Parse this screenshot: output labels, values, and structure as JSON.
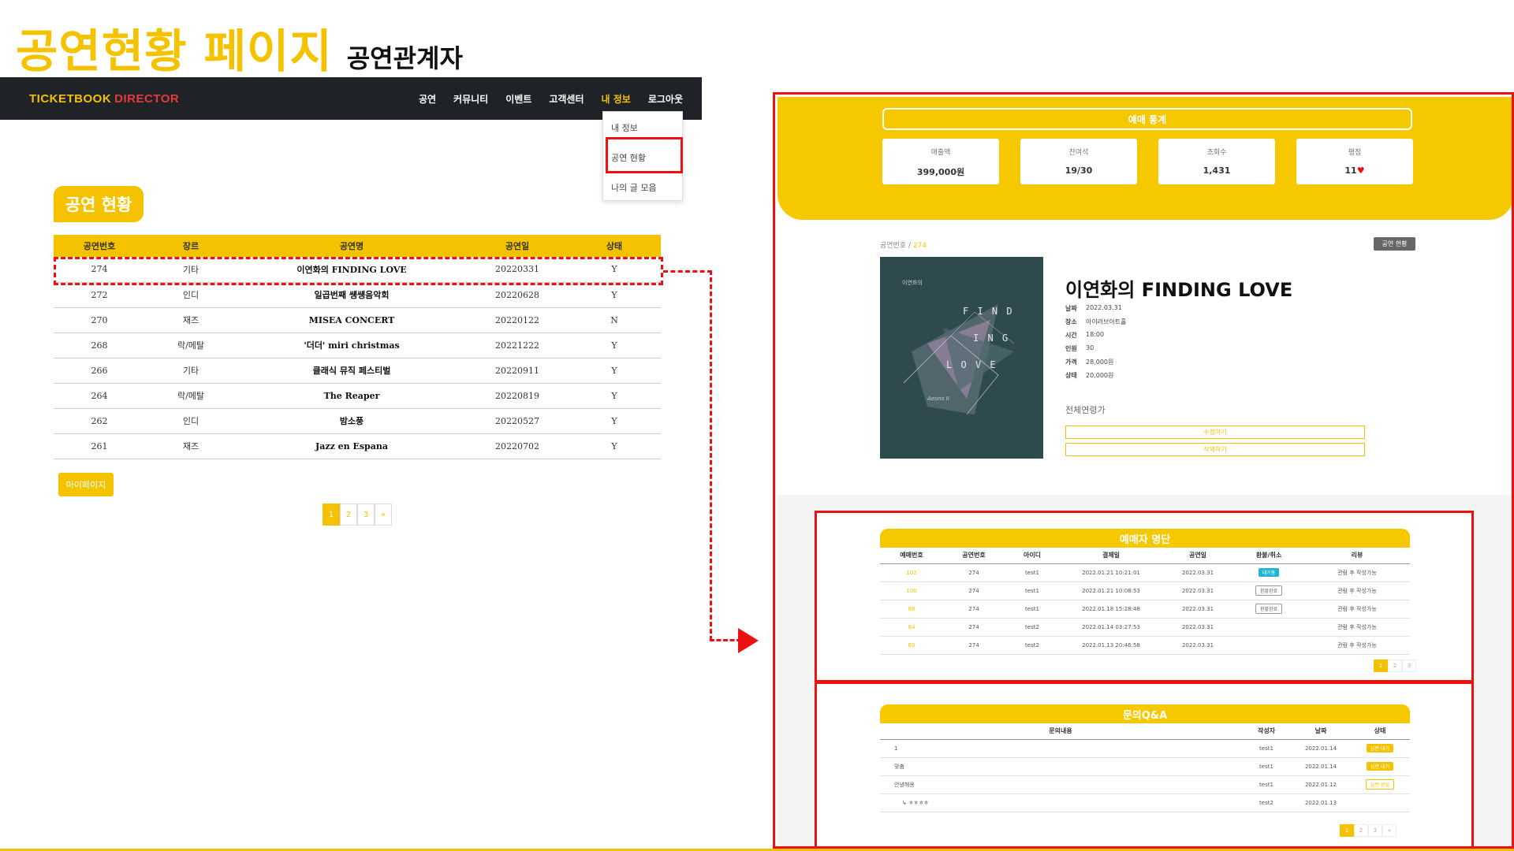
{
  "slide": {
    "title": "공연현황 페이지",
    "subtitle": "공연관계자"
  },
  "navbar": {
    "brand_primary": "TICKETBOOK",
    "brand_secondary": "DIRECTOR",
    "items": [
      "공연",
      "커뮤니티",
      "이벤트",
      "고객센터",
      "내 정보",
      "로그아웃"
    ],
    "active_item": "내 정보"
  },
  "dropdown": {
    "items": [
      "내 정보",
      "공연 현황",
      "나의 글 모음"
    ],
    "highlighted": "공연 현황"
  },
  "performance_list": {
    "heading": "공연 현황",
    "columns": [
      "공연번호",
      "장르",
      "공연명",
      "공연일",
      "상태"
    ],
    "rows": [
      [
        "274",
        "기타",
        "이연화의 FINDING LOVE",
        "20220331",
        "Y"
      ],
      [
        "272",
        "인디",
        "일곱번째 썡썡음악회",
        "20220628",
        "Y"
      ],
      [
        "270",
        "재즈",
        "MISEA CONCERT",
        "20220122",
        "N"
      ],
      [
        "268",
        "락/메탈",
        "'더더' miri christmas",
        "20221222",
        "Y"
      ],
      [
        "266",
        "기타",
        "클래식 뮤직 페스티벌",
        "20220911",
        "Y"
      ],
      [
        "264",
        "락/메탈",
        "The Reaper",
        "20220819",
        "Y"
      ],
      [
        "262",
        "인디",
        "밤소풍",
        "20220527",
        "Y"
      ],
      [
        "261",
        "재즈",
        "Jazz en Espana",
        "20220702",
        "Y"
      ]
    ],
    "mypage_button": "마이페이지",
    "pagination": [
      "1",
      "2",
      "3",
      "»"
    ]
  },
  "detail": {
    "stats_title": "예매 통계",
    "stats": [
      {
        "label": "매출액",
        "value": "399,000원"
      },
      {
        "label": "잔여석",
        "value": "19/30"
      },
      {
        "label": "조회수",
        "value": "1,431"
      },
      {
        "label": "평점",
        "value": "11",
        "suffix": "♥"
      }
    ],
    "breadcrumb_label": "공연번호 / ",
    "breadcrumb_number": "274",
    "status_chip": "공연 현황",
    "poster": {
      "top_text": "이연화의",
      "lines": [
        "F I N D",
        "I N G",
        "L O V E"
      ],
      "signature": "Aeons II"
    },
    "title": "이연화의 FINDING LOVE",
    "info": [
      {
        "key": "날짜",
        "value": "2022.03.31"
      },
      {
        "key": "장소",
        "value": "아이러브아트홀"
      },
      {
        "key": "시간",
        "value": "18:00"
      },
      {
        "key": "인원",
        "value": "30"
      },
      {
        "key": "가격",
        "value": "28,000원"
      },
      {
        "key": "상태",
        "value": "20,000원"
      }
    ],
    "age_note": "전체연령가",
    "buttons": [
      "수정하기",
      "삭제하기"
    ]
  },
  "reservations": {
    "heading": "예매자 명단",
    "columns": [
      "예매번호",
      "공연번호",
      "아이디",
      "결제일",
      "공연일",
      "환불/취소",
      "리뷰"
    ],
    "rows": [
      [
        "102",
        "274",
        "test1",
        "2022.01.21 10:21:01",
        "2022.03.31",
        "대기중",
        "관람 후 작성가능"
      ],
      [
        "100",
        "274",
        "test1",
        "2022.01.21 10:08:53",
        "2022.03.31",
        "환불완료",
        "관람 후 작성가능"
      ],
      [
        "88",
        "274",
        "test1",
        "2022.01.18 15:28:48",
        "2022.03.31",
        "환불완료",
        "관람 후 작성가능"
      ],
      [
        "84",
        "274",
        "test2",
        "2022.01.14 03:27:53",
        "2022.03.31",
        "",
        "관람 후 작성가능"
      ],
      [
        "80",
        "274",
        "test2",
        "2022.01.13 20:46:58",
        "2022.03.31",
        "",
        "관람 후 작성가능"
      ]
    ],
    "pagination": [
      "1",
      "2",
      "3"
    ]
  },
  "qna": {
    "heading": "문의Q&A",
    "columns": [
      "문의내용",
      "작성자",
      "날짜",
      "상태"
    ],
    "rows": [
      [
        "1",
        "test1",
        "2022.01.14",
        "답변 대기"
      ],
      [
        "맞춤",
        "test1",
        "2022.01.14",
        "답변 대기"
      ],
      [
        "안녕해용",
        "test1",
        "2022.01.12",
        "답변 완료"
      ],
      [
        "↳ ㅎㅎㅎㅎ",
        "test2",
        "2022.01.13",
        ""
      ]
    ],
    "pagination": [
      "1",
      "2",
      "3",
      "»"
    ]
  }
}
